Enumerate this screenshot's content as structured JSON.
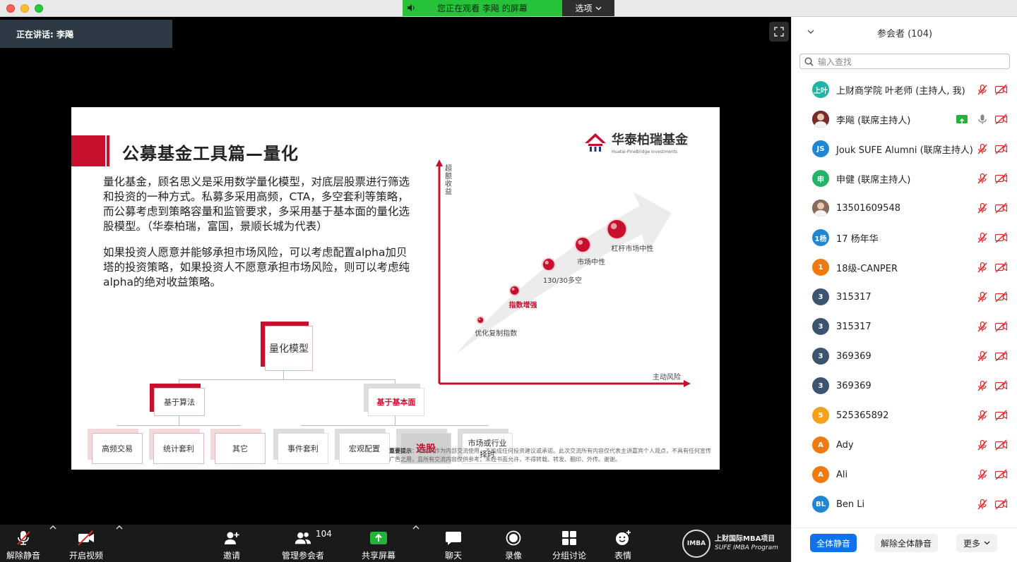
{
  "window": {
    "share_banner": "您正在观看 李飚 的屏幕",
    "options_label": "选项"
  },
  "stage": {
    "speaking_label": "正在讲话: 李飚"
  },
  "slide": {
    "title": "公募基金工具篇—量化",
    "logo_text": "华泰柏瑞基金",
    "logo_sub": "Huatai-PineBridge Investments",
    "para1": "量化基金，顾名思义是采用数学量化模型，对底层股票进行筛选和投资的一种方式。私募多采用高频，CTA，多空套利等策略，而公募考虑到策略容量和监管要求，多采用基于基本面的量化选股模型。（华泰柏瑞，富国，景顺长城为代表）",
    "para2": "如果投资人愿意并能够承担市场风险，可以考虑配置alpha加贝塔的投资策略，如果投资人不愿意承担市场风险，则可以考虑纯alpha的绝对收益策略。",
    "tree": {
      "root": "量化模型",
      "left": "基于算法",
      "right": "基于基本面",
      "left_children": [
        "高频交易",
        "统计套利",
        "其它"
      ],
      "right_children": [
        "事件套利",
        "宏观配置",
        "选股",
        "市场或行业择时"
      ]
    },
    "disclaimer_bold": "重要提示",
    "disclaimer": "：本材料作为内部交流使用，不构成任何投资建议或承诺。此次交流所有内容仅代表主讲嘉宾个人观点，不具有任何宣传广告之用，且所有交流内容仅供参考，未经书面允许，不得转载、转发、翻印、外传。谢谢。",
    "chart_data": {
      "type": "scatter",
      "xlabel": "主动风险",
      "ylabel": "超额收益",
      "points": [
        {
          "label": "优化复制指数",
          "x": 1,
          "y": 1,
          "highlight": false
        },
        {
          "label": "指数增强",
          "x": 2,
          "y": 2,
          "highlight": true
        },
        {
          "label": "130/30多空",
          "x": 3,
          "y": 3,
          "highlight": false
        },
        {
          "label": "市场中性",
          "x": 4,
          "y": 4,
          "highlight": false
        },
        {
          "label": "杠杆市场中性",
          "x": 5,
          "y": 5,
          "highlight": false
        }
      ]
    }
  },
  "panel": {
    "title": "参会者 (104)",
    "search_placeholder": "输入查找",
    "participants": [
      {
        "name": "上财商学院 叶老师 (主持人, 我)",
        "avatar": "上叶",
        "color": "#1fb5a6",
        "mic": "muted",
        "video": "off",
        "sharing": false,
        "photo": false
      },
      {
        "name": "李飚 (联席主持人)",
        "avatar": "",
        "color": "#7a2a2a",
        "mic": "on",
        "video": "off",
        "sharing": true,
        "photo": true
      },
      {
        "name": "Jouk SUFE Alumni (联席主持人)",
        "avatar": "JS",
        "color": "#1f86d6",
        "mic": "muted",
        "video": "off",
        "sharing": false,
        "photo": false
      },
      {
        "name": "申健 (联席主持人)",
        "avatar": "申",
        "color": "#22b56a",
        "mic": "muted",
        "video": "off",
        "sharing": false,
        "photo": false
      },
      {
        "name": "13501609548",
        "avatar": "",
        "color": "#8a6a5a",
        "mic": "muted",
        "video": "off",
        "sharing": false,
        "photo": true
      },
      {
        "name": "17 杨年华",
        "avatar": "1杨",
        "color": "#1f86d6",
        "mic": "muted",
        "video": "off",
        "sharing": false,
        "photo": false
      },
      {
        "name": "18级-CANPER",
        "avatar": "1",
        "color": "#f07a12",
        "mic": "muted",
        "video": "off",
        "sharing": false,
        "photo": false
      },
      {
        "name": "315317",
        "avatar": "3",
        "color": "#3d5470",
        "mic": "muted",
        "video": "off",
        "sharing": false,
        "photo": false
      },
      {
        "name": "315317",
        "avatar": "3",
        "color": "#3d5470",
        "mic": "muted",
        "video": "off",
        "sharing": false,
        "photo": false
      },
      {
        "name": "369369",
        "avatar": "3",
        "color": "#3d5470",
        "mic": "muted",
        "video": "off",
        "sharing": false,
        "photo": false
      },
      {
        "name": "369369",
        "avatar": "3",
        "color": "#3d5470",
        "mic": "muted",
        "video": "off",
        "sharing": false,
        "photo": false
      },
      {
        "name": "525365892",
        "avatar": "5",
        "color": "#f5a11c",
        "mic": "muted",
        "video": "off",
        "sharing": false,
        "photo": false
      },
      {
        "name": "Ady",
        "avatar": "A",
        "color": "#f07a12",
        "mic": "muted",
        "video": "off",
        "sharing": false,
        "photo": false
      },
      {
        "name": "Ali",
        "avatar": "A",
        "color": "#f07a12",
        "mic": "muted",
        "video": "off",
        "sharing": false,
        "photo": false
      },
      {
        "name": "Ben Li",
        "avatar": "BL",
        "color": "#1f86d6",
        "mic": "muted",
        "video": "off",
        "sharing": false,
        "photo": false
      }
    ],
    "mute_all": "全体静音",
    "unmute_all": "解除全体静音",
    "more": "更多"
  },
  "toolbar": {
    "unmute": "解除静音",
    "start_video": "开启视频",
    "invite": "邀请",
    "manage_participants": "管理参会者",
    "participant_count": "104",
    "share_screen": "共享屏幕",
    "chat": "聊天",
    "record": "录像",
    "breakout": "分组讨论",
    "reactions": "表情",
    "brand_cn": "上财国际MBA项目",
    "brand_en": "SUFE IMBA Program",
    "brand_seal": "IMBA"
  }
}
